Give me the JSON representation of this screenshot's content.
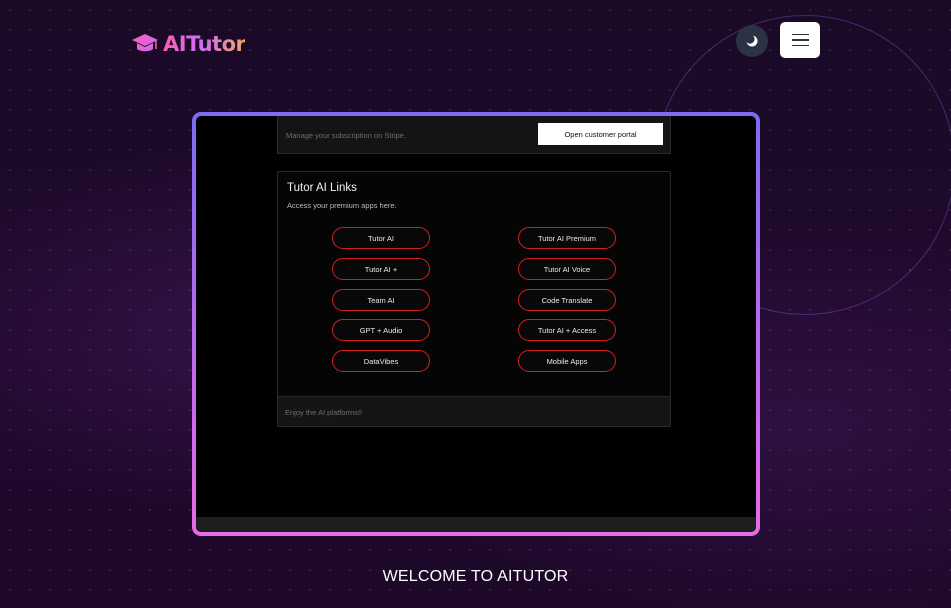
{
  "header": {
    "logo_text": "AITutor",
    "theme_toggle_icon": "moon-icon",
    "menu_icon": "hamburger-icon"
  },
  "preview": {
    "subscription": {
      "text": "Manage your subscription on Stripe.",
      "button_label": "Open customer portal"
    },
    "links_card": {
      "title": "Tutor AI Links",
      "description": "Access your premium apps here.",
      "left_links": [
        "Tutor AI",
        "Tutor AI +",
        "Team AI",
        "GPT + Audio",
        "DataVibes"
      ],
      "right_links": [
        "Tutor AI Premium",
        "Tutor AI Voice",
        "Code Translate",
        "Tutor AI + Access",
        "Mobile Apps"
      ],
      "footer_text": "Enjoy the AI platforms!!"
    }
  },
  "hero": {
    "heading": "WELCOME TO AITUTOR"
  },
  "colors": {
    "background": "#1a0a25",
    "frame_gradient_top": "#7b6cf3",
    "frame_gradient_bottom": "#e86ae8",
    "pill_border": "#d61e1e"
  }
}
